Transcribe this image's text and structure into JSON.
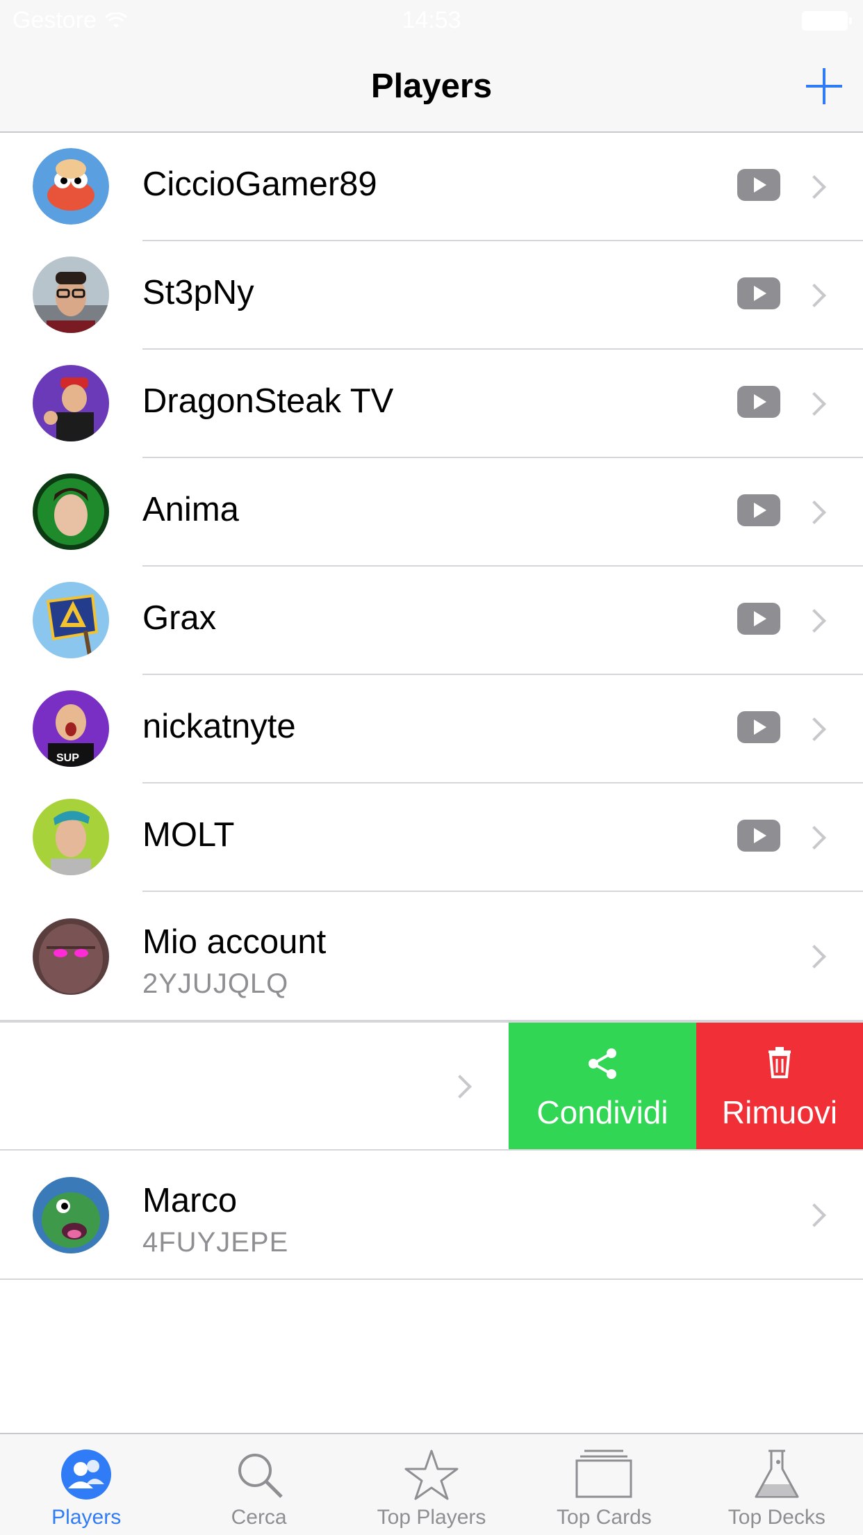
{
  "status_bar": {
    "carrier": "Gestore",
    "time": "14:53"
  },
  "nav": {
    "title": "Players"
  },
  "players": [
    {
      "name": "CiccioGamer89",
      "youtube": true,
      "avatar": "hermit-crab",
      "avatar_color": "#e8543a"
    },
    {
      "name": "St3pNy",
      "youtube": true,
      "avatar": "person-glasses",
      "avatar_color": "#8a8f96"
    },
    {
      "name": "DragonSteak TV",
      "youtube": true,
      "avatar": "cartoon-person",
      "avatar_color": "#6a3ab8"
    },
    {
      "name": "Anima",
      "youtube": true,
      "avatar": "person-green",
      "avatar_color": "#1f8a2c"
    },
    {
      "name": "Grax",
      "youtube": true,
      "avatar": "flag-logo",
      "avatar_color": "#5aa7e0"
    },
    {
      "name": "nickatnyte",
      "youtube": true,
      "avatar": "person-purple",
      "avatar_color": "#7a2fc4"
    },
    {
      "name": "MOLT",
      "youtube": true,
      "avatar": "person-lime",
      "avatar_color": "#a7d23a"
    },
    {
      "name": "Mio account",
      "tag": "2YJUJQLQ",
      "youtube": false,
      "avatar": "golem",
      "avatar_color": "#6b4a4a"
    }
  ],
  "swipe_actions": {
    "share_label": "Condividi",
    "remove_label": "Rimuovi",
    "share_color": "#31d654",
    "remove_color": "#f02f36"
  },
  "last_player": {
    "name": "Marco",
    "tag": "4FUYJEPE",
    "avatar": "baby-dragon",
    "avatar_color": "#3e9a4a"
  },
  "tabs": [
    {
      "label": "Players",
      "icon": "players-icon",
      "active": true
    },
    {
      "label": "Cerca",
      "icon": "search-icon",
      "active": false
    },
    {
      "label": "Top Players",
      "icon": "star-icon",
      "active": false
    },
    {
      "label": "Top Cards",
      "icon": "cards-icon",
      "active": false
    },
    {
      "label": "Top Decks",
      "icon": "flask-icon",
      "active": false
    }
  ],
  "accent_color": "#2f7cf6"
}
